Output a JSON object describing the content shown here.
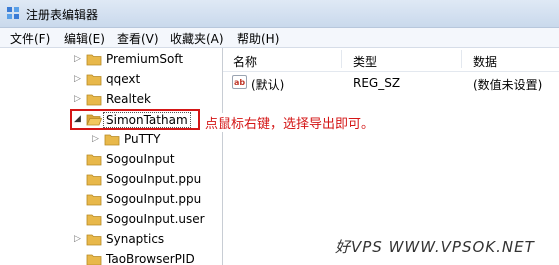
{
  "window": {
    "title": "注册表编辑器"
  },
  "menu": [
    {
      "label": "文件(F)"
    },
    {
      "label": "编辑(E)"
    },
    {
      "label": "查看(V)"
    },
    {
      "label": "收藏夹(A)"
    },
    {
      "label": "帮助(H)"
    }
  ],
  "tree": {
    "items": [
      {
        "label": "PremiumSoft",
        "expander": "▷"
      },
      {
        "label": "qqext",
        "expander": "▷"
      },
      {
        "label": "Realtek",
        "expander": "▷"
      },
      {
        "label": "SimonTatham",
        "expander": "◢"
      },
      {
        "label": "PuTTY",
        "expander": "▷"
      },
      {
        "label": "SogouInput",
        "expander": ""
      },
      {
        "label": "SogouInput.ppu",
        "expander": ""
      },
      {
        "label": "SogouInput.ppu",
        "expander": ""
      },
      {
        "label": "SogouInput.user",
        "expander": ""
      },
      {
        "label": "Synaptics",
        "expander": "▷"
      },
      {
        "label": "TaoBrowserPID",
        "expander": ""
      }
    ]
  },
  "list": {
    "headers": {
      "name": "名称",
      "type": "类型",
      "data": "数据"
    },
    "rows": [
      {
        "name": "(默认)",
        "type": "REG_SZ",
        "data": "(数值未设置)"
      }
    ]
  },
  "annotation": "点鼠标右键，选择导出即可。",
  "watermark": "好VPS WWW.VPSOK.NET",
  "colors": {
    "annotation": "#d41616",
    "folder": "#e8b84a"
  }
}
